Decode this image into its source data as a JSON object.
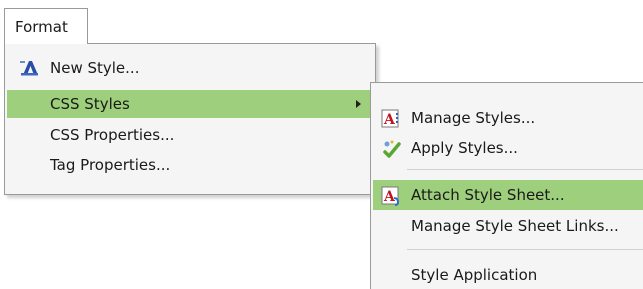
{
  "menubar": {
    "format_label": "Format"
  },
  "format_menu": {
    "items": [
      {
        "label": "New Style...",
        "icon": "new-style-icon"
      },
      {
        "label": "CSS Styles",
        "has_submenu": true,
        "highlighted": true
      },
      {
        "label": "CSS Properties..."
      },
      {
        "label": "Tag Properties..."
      }
    ]
  },
  "css_styles_submenu": {
    "items": [
      {
        "label": "Manage Styles...",
        "icon": "manage-styles-icon"
      },
      {
        "label": "Apply Styles...",
        "icon": "apply-styles-icon"
      },
      {
        "label": "Attach Style Sheet...",
        "icon": "attach-style-sheet-icon",
        "highlighted": true
      },
      {
        "label": "Manage Style Sheet Links..."
      },
      {
        "label": "Style Application"
      }
    ]
  },
  "colors": {
    "highlight": "#9ecf7c",
    "menu_bg": "#f5f5f5",
    "border": "#9a9a9a"
  }
}
